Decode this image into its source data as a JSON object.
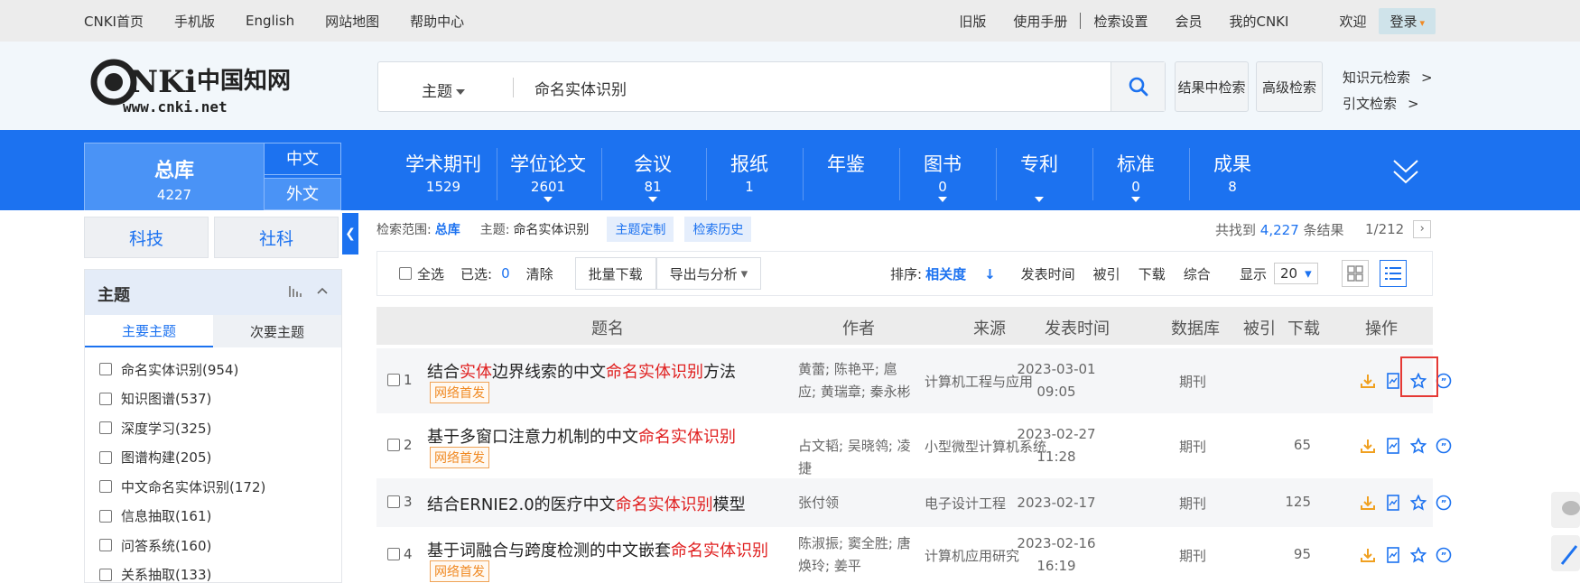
{
  "topbar": {
    "left_links": [
      "CNKI首页",
      "手机版",
      "English",
      "网站地图",
      "帮助中心"
    ],
    "right_links": [
      "旧版",
      "使用手册"
    ],
    "right_links2": [
      "检索设置",
      "会员",
      "我的CNKI",
      "欢迎"
    ],
    "login_label": "登录"
  },
  "header": {
    "logo_text": "www.cnki.net",
    "logo_cn": "中国知网",
    "search": {
      "type_label": "主题",
      "query": "命名实体识别"
    },
    "btn_in_result": "结果中检索",
    "btn_advanced": "高级检索",
    "side_links": [
      "知识元检索",
      "引文检索"
    ],
    "arrow": ">"
  },
  "nav": {
    "zongku": {
      "label": "总库",
      "count": "4227"
    },
    "lang_zh": "中文",
    "lang_wai": "外文",
    "items": [
      {
        "label": "学术期刊",
        "count": "1529",
        "caret": false
      },
      {
        "label": "学位论文",
        "count": "2601",
        "caret": true
      },
      {
        "label": "会议",
        "count": "81",
        "caret": true
      },
      {
        "label": "报纸",
        "count": "1",
        "caret": false
      },
      {
        "label": "年鉴",
        "count": "",
        "caret": false
      },
      {
        "label": "图书",
        "count": "0",
        "caret": true
      },
      {
        "label": "专利",
        "count": "",
        "caret": true
      },
      {
        "label": "标准",
        "count": "0",
        "caret": true
      },
      {
        "label": "成果",
        "count": "8",
        "caret": false
      }
    ]
  },
  "sidebar": {
    "cat_tech": "科技",
    "cat_social": "社科",
    "panel_title": "主题",
    "tab_main": "主要主题",
    "tab_sub": "次要主题",
    "topics": [
      "命名实体识别(954)",
      "知识图谱(537)",
      "深度学习(325)",
      "图谱构建(205)",
      "中文命名实体识别(172)",
      "信息抽取(161)",
      "问答系统(160)",
      "关系抽取(133)"
    ]
  },
  "results": {
    "scope_label": "检索范围:",
    "scope_value": "总库",
    "topic_label": "主题:",
    "topic_value": "命名实体识别",
    "btn_topic_custom": "主题定制",
    "btn_history": "检索历史",
    "found_prefix": "共找到",
    "found_count": "4,227",
    "found_suffix": "条结果",
    "page": "1/212",
    "toolbar": {
      "select_all": "全选",
      "selected_label": "已选:",
      "selected_count": "0",
      "clear": "清除",
      "batch_download": "批量下载",
      "export": "导出与分析",
      "sort_label": "排序:",
      "sort_active": "相关度",
      "sort_opts": [
        "发表时间",
        "被引",
        "下载",
        "综合"
      ],
      "display_label": "显示",
      "display_value": "20"
    },
    "headers": [
      "题名",
      "作者",
      "来源",
      "发表时间",
      "数据库",
      "被引",
      "下载",
      "操作"
    ],
    "rows": [
      {
        "num": "1",
        "title_parts": [
          {
            "t": "结合",
            "h": false
          },
          {
            "t": "实体",
            "h": true
          },
          {
            "t": "边界线索的中文",
            "h": false
          },
          {
            "t": "命名实体识别",
            "h": true
          },
          {
            "t": "方法",
            "h": false
          }
        ],
        "badge": "网络首发",
        "authors": "黄蕾; 陈艳平; 扈应; 黄瑞章; 秦永彬",
        "source": "计算机工程与应用",
        "date": "2023-03-01",
        "time": "09:05",
        "db": "期刊",
        "cite": ""
      },
      {
        "num": "2",
        "title_parts": [
          {
            "t": "基于多窗口注意力机制的中文",
            "h": false
          },
          {
            "t": "命名实体识别",
            "h": true
          }
        ],
        "badge": "网络首发",
        "authors": "占文韬; 吴晓鸰; 凌捷",
        "source": "小型微型计算机系统",
        "date": "2023-02-27",
        "time": "11:28",
        "db": "期刊",
        "cite": "65"
      },
      {
        "num": "3",
        "title_parts": [
          {
            "t": "结合ERNIE2.0的医疗中文",
            "h": false
          },
          {
            "t": "命名实体识别",
            "h": true
          },
          {
            "t": "模型",
            "h": false
          }
        ],
        "badge": "",
        "authors": "张付领",
        "source": "电子设计工程",
        "date": "2023-02-17",
        "time": "",
        "db": "期刊",
        "cite": "125"
      },
      {
        "num": "4",
        "title_parts": [
          {
            "t": "基于词融合与跨度检测的中文嵌套",
            "h": false
          },
          {
            "t": "命名实体识别",
            "h": true
          }
        ],
        "badge": "网络首发",
        "authors": "陈淑振; 窦全胜; 唐焕玲; 姜平",
        "source": "计算机应用研究",
        "date": "2023-02-16",
        "time": "16:19",
        "db": "期刊",
        "cite": "95"
      }
    ]
  },
  "colors": {
    "brand_blue": "#1c72f0",
    "highlight_red": "#e02020",
    "badge_orange": "#f08a24",
    "icon_orange": "#f0a020"
  }
}
